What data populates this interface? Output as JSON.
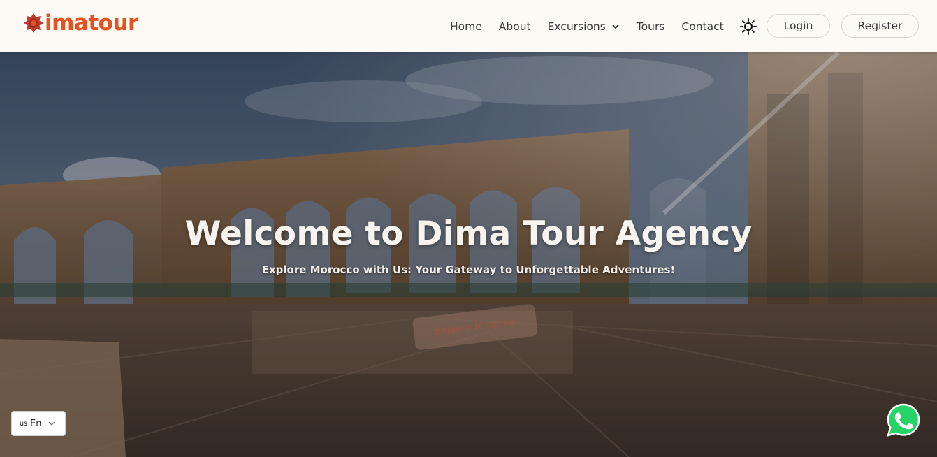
{
  "brand": {
    "logo_text": "imatour",
    "logo_color": "#e6521f"
  },
  "nav": {
    "home": "Home",
    "about": "About",
    "excursions": "Excursions",
    "tours": "Tours",
    "contact": "Contact",
    "theme_icon": "sun-icon",
    "login": "Login",
    "register": "Register"
  },
  "hero": {
    "title": "Welcome to Dima Tour Agency",
    "subtitle": "Explore Morocco with Us: Your Gateway to Unforgettable Adventures!",
    "cta": "Explore Morocco"
  },
  "language": {
    "flag": "us",
    "code": "En",
    "icon": "chevron-down-icon"
  },
  "whatsapp": {
    "icon": "whatsapp-icon",
    "color": "#25d366"
  },
  "colors": {
    "header_bg": "#fdfaf6",
    "accent": "#e6521f",
    "text": "#3a3a3a"
  }
}
